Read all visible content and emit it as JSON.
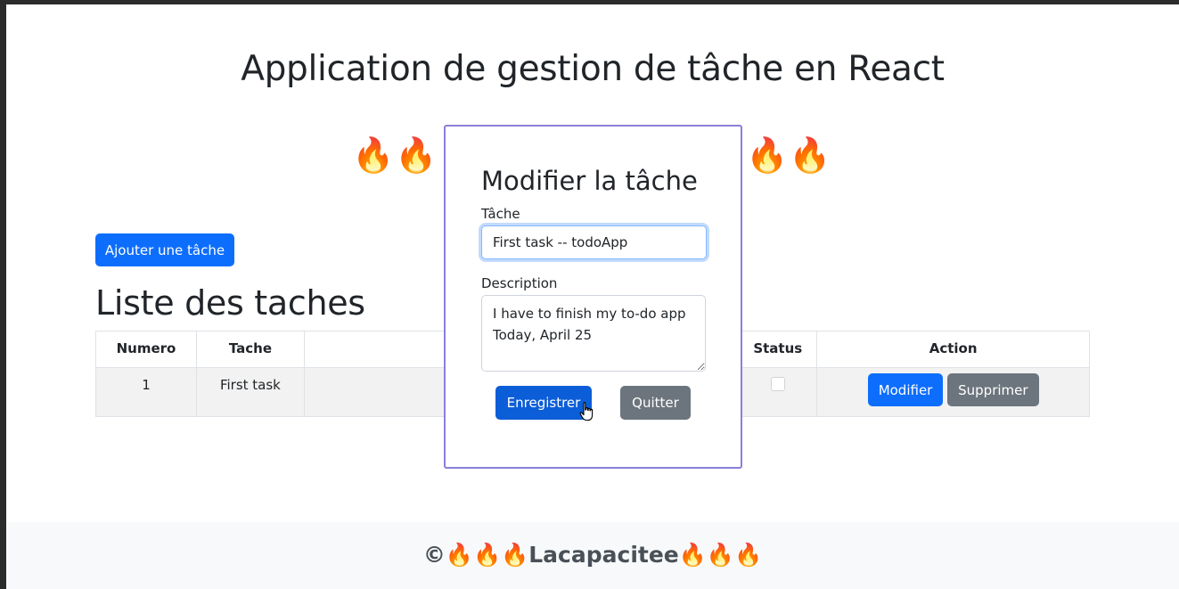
{
  "app": {
    "title": "Application de gestion de tâche en React",
    "fire_left": [
      "🔥",
      "🔥"
    ],
    "fire_right": [
      "🔥",
      "🔥"
    ],
    "add_button": "Ajouter une tâche",
    "list_title": "Liste des taches"
  },
  "table": {
    "headers": [
      "Numero",
      "Tache",
      "",
      "Status",
      "Action"
    ],
    "rows": [
      {
        "numero": "1",
        "tache": "First task",
        "description": "I have to fi",
        "status_checked": false,
        "modify_label": "Modifier",
        "delete_label": "Supprimer"
      }
    ]
  },
  "modal": {
    "title": "Modifier la tâche",
    "task_label": "Tâche",
    "task_value": "First task -- todoApp",
    "description_label": "Description",
    "description_value": "I have to finish my to-do app\nToday, April 25",
    "save_label": "Enregistrer",
    "quit_label": "Quitter"
  },
  "footer": {
    "text": "©🔥🔥🔥Lacapacitee🔥🔥🔥"
  },
  "colors": {
    "primary": "#0d6efd",
    "secondary": "#6c757d",
    "modal_border": "#8a80d8",
    "footer_bg": "#f8f9fa"
  },
  "icons": {
    "cursor": "hand-pointer-icon",
    "fire": "fire-emoji"
  }
}
